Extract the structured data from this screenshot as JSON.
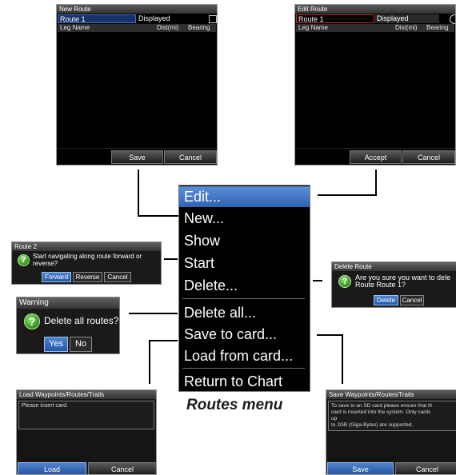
{
  "new_route": {
    "title": "New Route",
    "name_value": "Route 1",
    "displayed_label": "Displayed",
    "col_leg": "Leg Name",
    "col_dist": "Dist(mi)",
    "col_bearing": "Bearing",
    "save": "Save",
    "cancel": "Cancel"
  },
  "edit_route": {
    "title": "Edit Route",
    "name_value": "Route 1",
    "displayed_label": "Displayed",
    "col_leg": "Leg Name",
    "col_dist": "Dist(mi)",
    "col_bearing": "Bearing",
    "accept": "Accept",
    "cancel": "Cancel"
  },
  "menu": {
    "items": [
      "Edit...",
      "New...",
      "Show",
      "Start",
      "Delete...",
      "Delete all...",
      "Save to card...",
      "Load from card...",
      "Return to Chart"
    ],
    "selected": "Edit...",
    "caption": "Routes menu"
  },
  "route2_dialog": {
    "title": "Route 2",
    "message": "Start navigating along route forward or reverse?",
    "buttons": [
      "Forward",
      "Reverse",
      "Cancel"
    ],
    "selected": "Forward"
  },
  "warning_dialog": {
    "title": "Warning",
    "message": "Delete all routes?",
    "buttons": [
      "Yes",
      "No"
    ],
    "selected": "Yes"
  },
  "delete_route_dialog": {
    "title": "Delete Route",
    "message_line1": "Are you sure you want to dele",
    "message_line2": "Route Route 1?",
    "buttons": [
      "Delete",
      "Cancel"
    ],
    "selected": "Delete"
  },
  "load_panel": {
    "title": "Load Waypoints/Routes/Trails",
    "message": "Please insert card.",
    "load": "Load",
    "cancel": "Cancel"
  },
  "save_panel": {
    "title": "Save Waypoints/Routes/Trails",
    "line1": "To save to an SD card please ensure that th",
    "line2": "card is inserted into the system. Only cards",
    "line3": "up",
    "line4": "to 2GB (Giga-Bytes) are supported.",
    "save": "Save",
    "cancel": "Cancel"
  },
  "colors": {
    "accent_blue": "#2f63b2",
    "question_green": "#3a9a26",
    "edit_field_border": "#c0302a"
  },
  "icons": [
    "question-icon",
    "displayed-checkbox",
    "displayed-radio"
  ]
}
